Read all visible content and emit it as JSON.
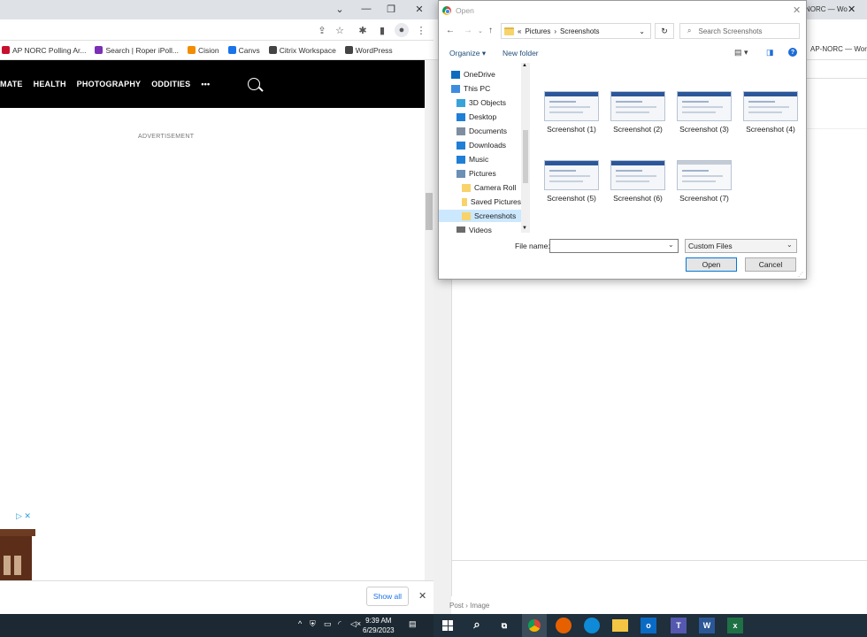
{
  "left_browser": {
    "window_controls": {
      "chevron": "⌄",
      "minimize": "—",
      "restore": "❐",
      "close": "✕"
    },
    "bookmarks": [
      {
        "label": "AP NORC Polling Ar...",
        "color": "#c8102e"
      },
      {
        "label": "Search | Roper iPoll...",
        "color": "#7a2fb5"
      },
      {
        "label": "Cision",
        "color": "#f28c00"
      },
      {
        "label": "Canvs",
        "color": "#1a73e8"
      },
      {
        "label": "Citrix Workspace",
        "color": "#444444"
      },
      {
        "label": "WordPress",
        "color": "#444444"
      }
    ],
    "nav": [
      "MATE",
      "HEALTH",
      "PHOTOGRAPHY",
      "ODDITIES",
      "•••"
    ],
    "advertisement_label": "ADVERTISEMENT",
    "download_bar": {
      "show_all": "Show all",
      "close": "✕"
    }
  },
  "right_browser": {
    "tab_title": "NORC — Wo",
    "bookmark": "AP-NORC — Word",
    "breadcrumb": "Post  ›  Image"
  },
  "dialog": {
    "title": "Open",
    "breadcrumb": {
      "prefix": "«",
      "parts": [
        "Pictures",
        "Screenshots"
      ],
      "separator": "›"
    },
    "search_placeholder": "Search Screenshots",
    "organize": "Organize ▾",
    "new_folder": "New folder",
    "nav_items": [
      {
        "label": "OneDrive",
        "color": "#0f6cbd",
        "indent": 0
      },
      {
        "label": "This PC",
        "color": "#3c8dde",
        "indent": 0
      },
      {
        "label": "3D Objects",
        "color": "#38a3d9",
        "indent": 1
      },
      {
        "label": "Desktop",
        "color": "#1f7fd6",
        "indent": 1
      },
      {
        "label": "Documents",
        "color": "#7f8da0",
        "indent": 1
      },
      {
        "label": "Downloads",
        "color": "#1f7fd6",
        "indent": 1
      },
      {
        "label": "Music",
        "color": "#1f7fd6",
        "indent": 1
      },
      {
        "label": "Pictures",
        "color": "#6b8fb5",
        "indent": 1
      },
      {
        "label": "Camera Roll",
        "color": "#f7d36a",
        "indent": 2
      },
      {
        "label": "Saved Pictures",
        "color": "#f7d36a",
        "indent": 2
      },
      {
        "label": "Screenshots",
        "color": "#f7d36a",
        "indent": 2,
        "selected": true
      },
      {
        "label": "Videos",
        "color": "#6b6b6b",
        "indent": 1
      }
    ],
    "files": [
      {
        "name": "Screenshot (1)"
      },
      {
        "name": "Screenshot (2)"
      },
      {
        "name": "Screenshot (3)"
      },
      {
        "name": "Screenshot (4)"
      },
      {
        "name": "Screenshot (5)"
      },
      {
        "name": "Screenshot (6)"
      },
      {
        "name": "Screenshot (7)",
        "light": true
      }
    ],
    "file_name_label": "File name:",
    "file_name_value": "",
    "file_type": "Custom Files",
    "open_button": "Open",
    "cancel_button": "Cancel"
  },
  "taskbar": {
    "time": "9:39 AM",
    "date": "6/29/2023"
  }
}
